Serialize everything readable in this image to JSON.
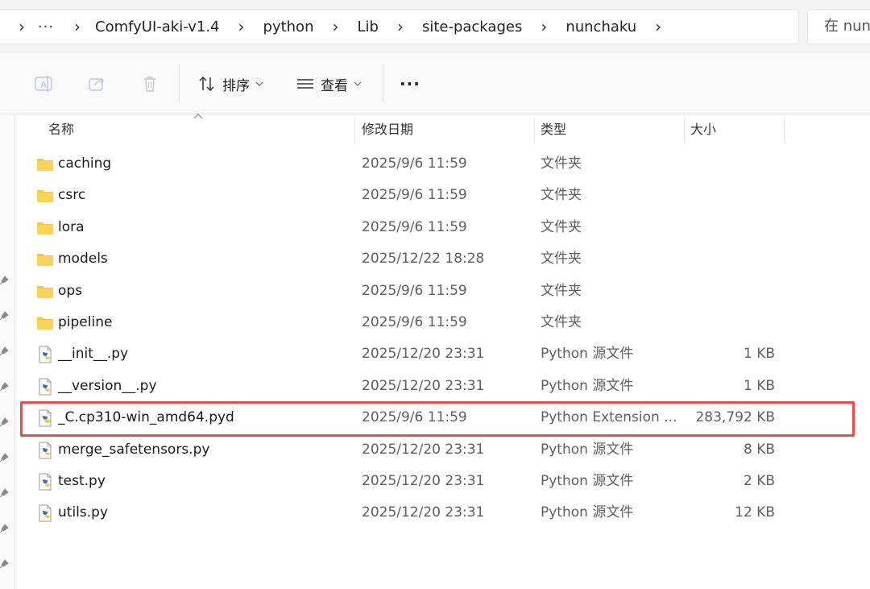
{
  "address_bar": {
    "more_label": "···",
    "breadcrumbs": [
      "ComfyUI-aki-v1.4",
      "python",
      "Lib",
      "site-packages",
      "nunchaku"
    ],
    "search_placeholder": "在 nunchaku 中搜索"
  },
  "toolbar": {
    "sort_label": "排序",
    "view_label": "查看",
    "more_label": "···",
    "icons": [
      "rename-icon",
      "share-icon",
      "delete-icon",
      "sort-icon",
      "view-icon"
    ]
  },
  "columns": {
    "name": "名称",
    "date": "修改日期",
    "type": "类型",
    "size": "大小"
  },
  "files": [
    {
      "name": "caching",
      "date": "2025/9/6 11:59",
      "type": "文件夹",
      "size": "",
      "kind": "folder"
    },
    {
      "name": "csrc",
      "date": "2025/9/6 11:59",
      "type": "文件夹",
      "size": "",
      "kind": "folder"
    },
    {
      "name": "lora",
      "date": "2025/9/6 11:59",
      "type": "文件夹",
      "size": "",
      "kind": "folder"
    },
    {
      "name": "models",
      "date": "2025/12/22 18:28",
      "type": "文件夹",
      "size": "",
      "kind": "folder"
    },
    {
      "name": "ops",
      "date": "2025/9/6 11:59",
      "type": "文件夹",
      "size": "",
      "kind": "folder"
    },
    {
      "name": "pipeline",
      "date": "2025/9/6 11:59",
      "type": "文件夹",
      "size": "",
      "kind": "folder"
    },
    {
      "name": "__init__.py",
      "date": "2025/12/20 23:31",
      "type": "Python 源文件",
      "size": "1 KB",
      "kind": "py"
    },
    {
      "name": "__version__.py",
      "date": "2025/12/20 23:31",
      "type": "Python 源文件",
      "size": "1 KB",
      "kind": "py"
    },
    {
      "name": "_C.cp310-win_amd64.pyd",
      "date": "2025/9/6 11:59",
      "type": "Python Extension ...",
      "size": "283,792 KB",
      "kind": "pyd"
    },
    {
      "name": "merge_safetensors.py",
      "date": "2025/12/20 23:31",
      "type": "Python 源文件",
      "size": "8 KB",
      "kind": "py"
    },
    {
      "name": "test.py",
      "date": "2025/12/20 23:31",
      "type": "Python 源文件",
      "size": "2 KB",
      "kind": "py"
    },
    {
      "name": "utils.py",
      "date": "2025/12/20 23:31",
      "type": "Python 源文件",
      "size": "12 KB",
      "kind": "py"
    }
  ],
  "highlighted_file": "_C.cp310-win_amd64.pyd",
  "colors": {
    "highlight_border": "#ec4b4b",
    "folder": "#f8c63a",
    "python_blue": "#3a72b0",
    "python_yellow": "#f2c94a"
  }
}
